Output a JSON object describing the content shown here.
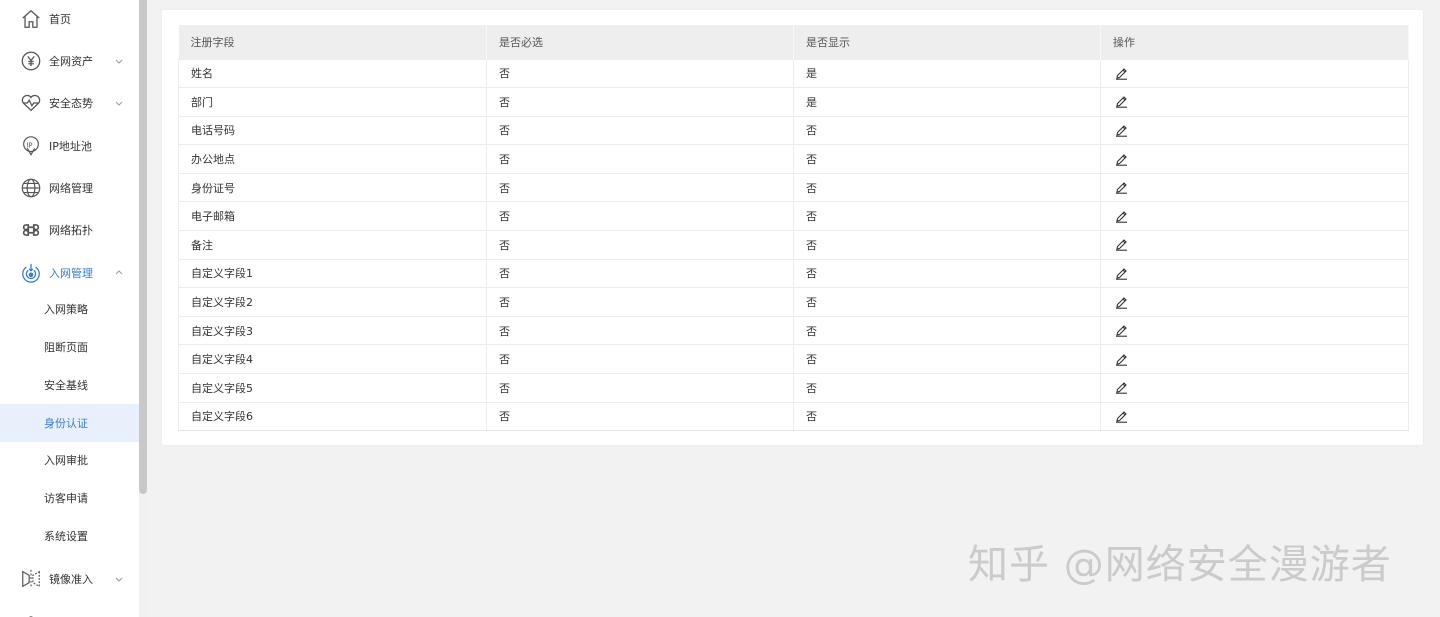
{
  "sidebar": {
    "items": [
      {
        "label": "首页",
        "icon": "home-icon"
      },
      {
        "label": "全网资产",
        "icon": "yen-circle-icon"
      },
      {
        "label": "安全态势",
        "icon": "heart-pulse-icon"
      },
      {
        "label": "IP地址池",
        "icon": "ip-location-icon"
      },
      {
        "label": "网络管理",
        "icon": "globe-icon"
      },
      {
        "label": "网络拓扑",
        "icon": "command-icon"
      },
      {
        "label": "入网管理",
        "icon": "access-signal-icon"
      }
    ],
    "subitems": [
      {
        "label": "入网策略"
      },
      {
        "label": "阻断页面"
      },
      {
        "label": "安全基线"
      },
      {
        "label": "身份认证"
      },
      {
        "label": "入网审批"
      },
      {
        "label": "访客申请"
      },
      {
        "label": "系统设置"
      }
    ],
    "bottom_items": [
      {
        "label": "镜像准入",
        "icon": "mirror-icon"
      }
    ],
    "accent_color": "#3a7bd5"
  },
  "table": {
    "headers": [
      "注册字段",
      "是否必选",
      "是否显示",
      "操作"
    ],
    "rows": [
      [
        "姓名",
        "否",
        "是"
      ],
      [
        "部门",
        "否",
        "是"
      ],
      [
        "电话号码",
        "否",
        "否"
      ],
      [
        "办公地点",
        "否",
        "否"
      ],
      [
        "身份证号",
        "否",
        "否"
      ],
      [
        "电子邮箱",
        "否",
        "否"
      ],
      [
        "备注",
        "否",
        "否"
      ],
      [
        "自定义字段1",
        "否",
        "否"
      ],
      [
        "自定义字段2",
        "否",
        "否"
      ],
      [
        "自定义字段3",
        "否",
        "否"
      ],
      [
        "自定义字段4",
        "否",
        "否"
      ],
      [
        "自定义字段5",
        "否",
        "否"
      ],
      [
        "自定义字段6",
        "否",
        "否"
      ]
    ]
  },
  "watermark": "知乎 @网络安全漫游者"
}
